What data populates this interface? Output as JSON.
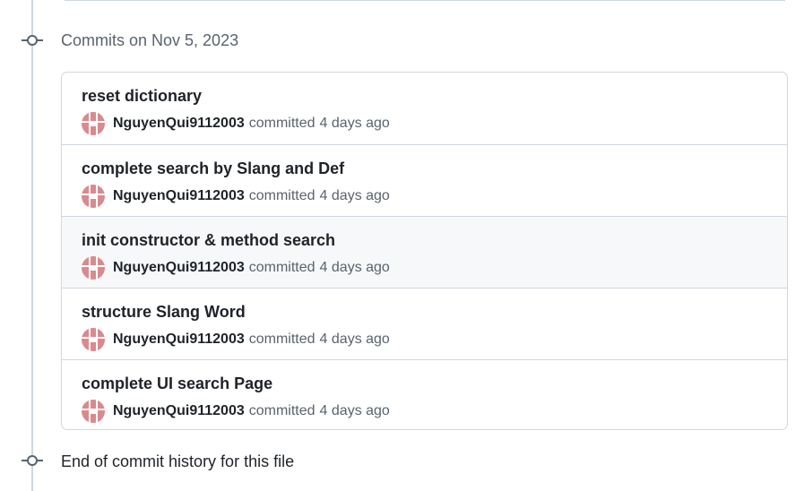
{
  "history": {
    "group_heading": "Commits on Nov 5, 2023",
    "commits": [
      {
        "title": "reset dictionary",
        "author": "NguyenQui9112003",
        "action": "committed",
        "time": "4 days ago"
      },
      {
        "title": "complete search by Slang and Def",
        "author": "NguyenQui9112003",
        "action": "committed",
        "time": "4 days ago"
      },
      {
        "title": "init constructor & method search",
        "author": "NguyenQui9112003",
        "action": "committed",
        "time": "4 days ago"
      },
      {
        "title": "structure Slang Word",
        "author": "NguyenQui9112003",
        "action": "committed",
        "time": "4 days ago"
      },
      {
        "title": "complete UI search Page",
        "author": "NguyenQui9112003",
        "action": "committed",
        "time": "4 days ago"
      }
    ],
    "end_text": "End of commit history for this file"
  },
  "icons": {
    "timeline_node": "git-commit-icon",
    "avatar": "identicon-avatar"
  },
  "colors": {
    "avatar": "#d98a8f",
    "hover_row": "#f6f8fa",
    "border": "#d0d7de",
    "muted_text": "#59636e"
  }
}
